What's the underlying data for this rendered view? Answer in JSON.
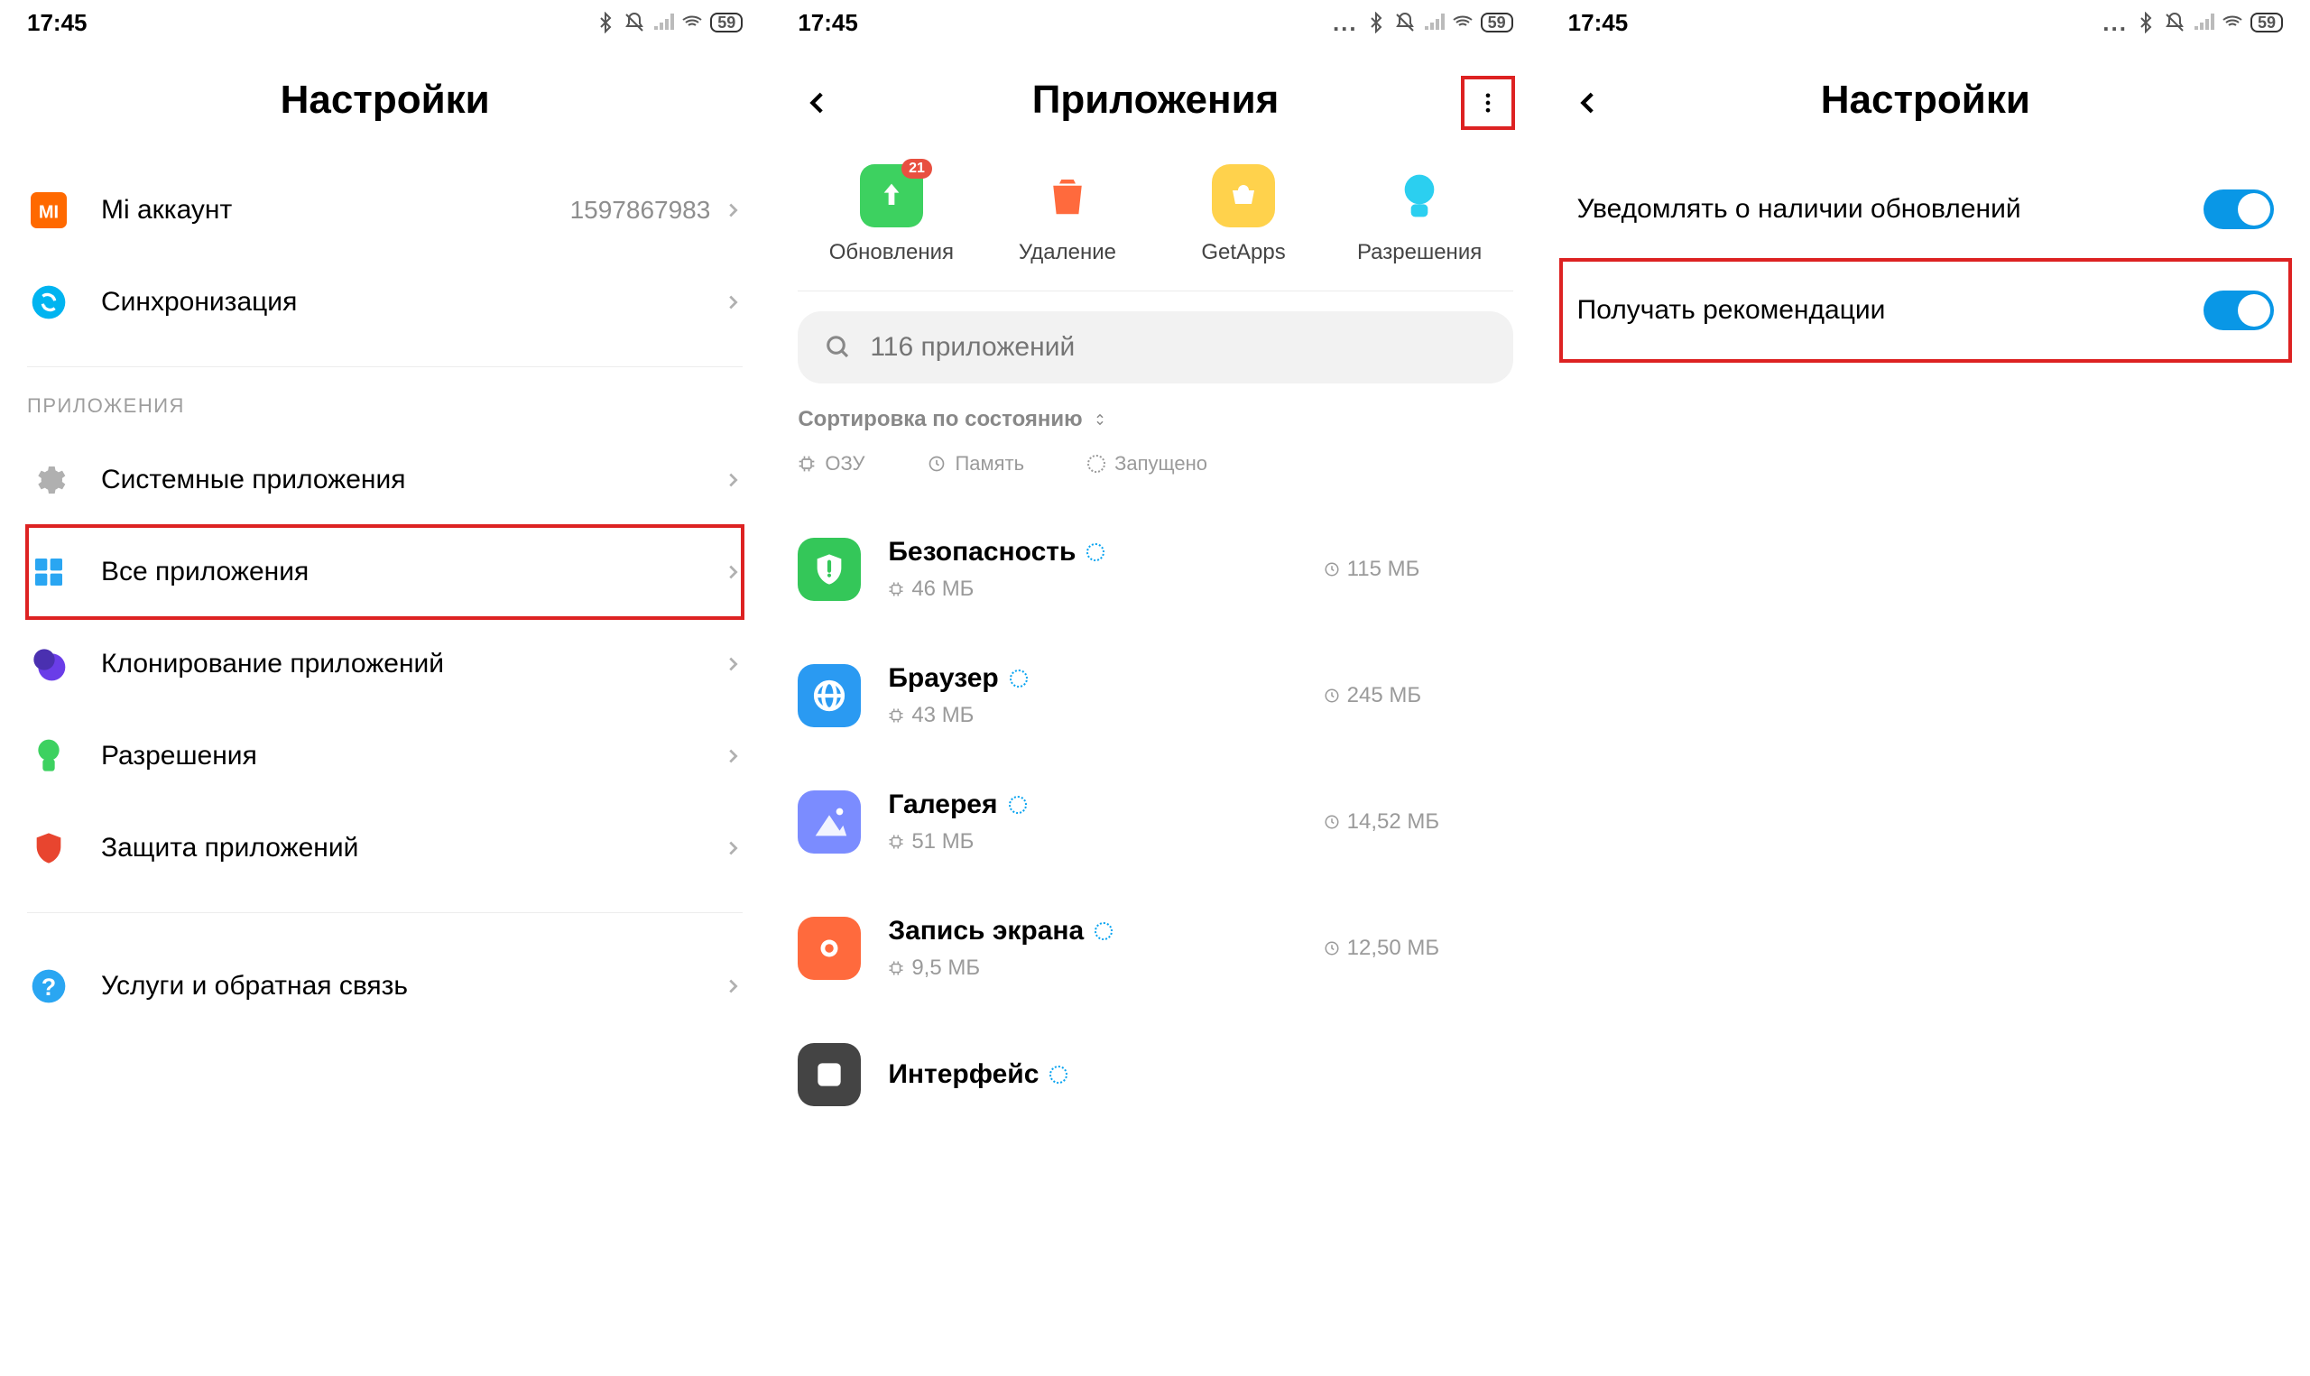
{
  "status": {
    "time": "17:45",
    "battery": "59"
  },
  "pane1": {
    "title": "Настройки",
    "account": {
      "label": "Mi аккаунт",
      "value": "1597867983"
    },
    "sync": "Синхронизация",
    "section": "ПРИЛОЖЕНИЯ",
    "items": [
      "Системные приложения",
      "Все приложения",
      "Клонирование приложений",
      "Разрешения",
      "Защита приложений"
    ],
    "feedback": "Услуги и обратная связь"
  },
  "pane2": {
    "title": "Приложения",
    "tiles": [
      {
        "label": "Обновления",
        "badge": "21"
      },
      {
        "label": "Удаление"
      },
      {
        "label": "GetApps"
      },
      {
        "label": "Разрешения"
      }
    ],
    "search_placeholder": "116 приложений",
    "sort": "Сортировка по состоянию",
    "tabs": [
      "ОЗУ",
      "Память",
      "Запущено"
    ],
    "apps": [
      {
        "name": "Безопасность",
        "ram": "46 МБ",
        "mem": "115 МБ",
        "bg": "#34c759"
      },
      {
        "name": "Браузер",
        "ram": "43 МБ",
        "mem": "245 МБ",
        "bg": "#2a9af2"
      },
      {
        "name": "Галерея",
        "ram": "51 МБ",
        "mem": "14,52 МБ",
        "bg": "#7b8cff"
      },
      {
        "name": "Запись экрана",
        "ram": "9,5 МБ",
        "mem": "12,50 МБ",
        "bg": "#ff6a3d"
      },
      {
        "name": "Интерфейс",
        "ram": "",
        "mem": "",
        "bg": "#444"
      }
    ]
  },
  "pane3": {
    "title": "Настройки",
    "opts": [
      "Уведомлять о наличии обновлений",
      "Получать рекомендации"
    ]
  }
}
